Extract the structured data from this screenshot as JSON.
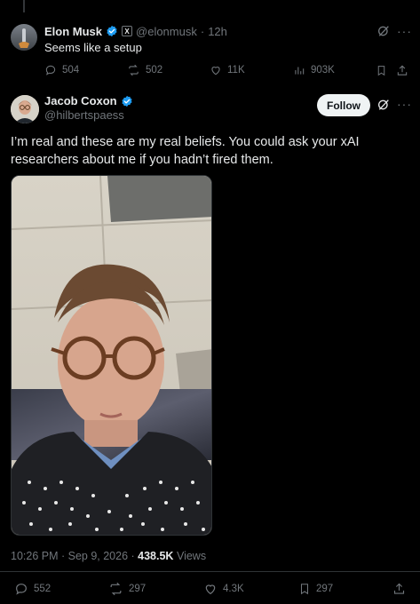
{
  "reply": {
    "author_name": "Elon Musk",
    "handle": "@elonmusk",
    "separator": "·",
    "time": "12h",
    "text": "Seems like a setup",
    "stats": {
      "replies": "504",
      "reposts": "502",
      "likes": "11K",
      "views": "903K"
    }
  },
  "main": {
    "author_name": "Jacob Coxon",
    "handle": "@hilbertspaess",
    "follow_label": "Follow",
    "text": "I’m real and these are my real beliefs. You could ask your xAI researchers about me if you hadn’t fired them.",
    "timestamp": "10:26 PM · Sep 9, 2026 ·",
    "views_count": "438.5K",
    "views_label": "Views",
    "stats": {
      "replies": "552",
      "reposts": "297",
      "likes": "4.3K",
      "bookmarks": "297"
    }
  },
  "colors": {
    "background": "#000000",
    "verified": "#1d9bf0",
    "muted": "#71767b",
    "follow_bg": "#eff3f4"
  }
}
